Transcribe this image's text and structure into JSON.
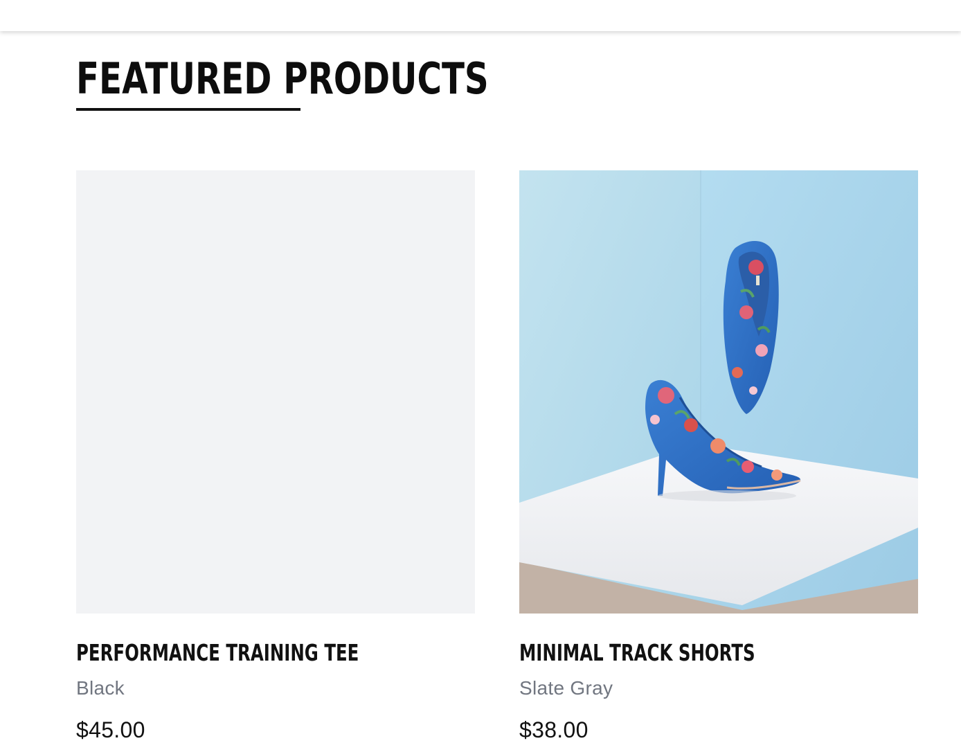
{
  "section": {
    "heading": "FEATURED PRODUCTS"
  },
  "products": [
    {
      "title": "PERFORMANCE TRAINING TEE",
      "color": "Black",
      "price": "$45.00"
    },
    {
      "title": "MINIMAL TRACK SHORTS",
      "color": "Slate Gray",
      "price": "$38.00"
    }
  ],
  "colors": {
    "heading": "#0d0d0d",
    "muted_text": "#717680",
    "placeholder_bg": "#f2f3f5",
    "wall_blue": "#a9d8ee",
    "shoe_blue": "#2f6fc4"
  }
}
